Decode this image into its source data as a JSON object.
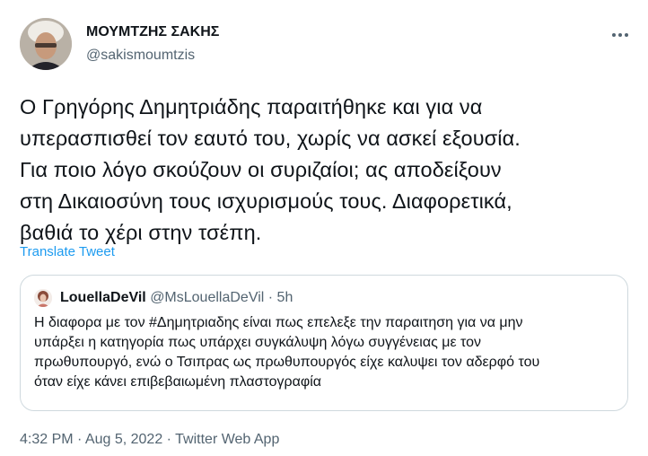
{
  "author": {
    "name": "ΜΟΥΜΤΖΗΣ ΣΑΚΗΣ",
    "handle": "@sakismoumtzis"
  },
  "tweet": {
    "text": "Ο Γρηγόρης Δημητριάδης παραιτήθηκε και για να\nυπερασπισθεί τον εαυτό του, χωρίς να ασκεί εξουσία.\nΓια ποιο λόγο σκούζουν οι συριζαίοι; ας αποδείξουν\nστη Δικαιοσύνη τους ισχυρισμούς τους.  Διαφορετικά,\nβαθιά το χέρι στην τσέπη.",
    "translate_label": "Translate Tweet"
  },
  "quoted_tweet": {
    "name": "LouellaDeVil",
    "handle": "@MsLouellaDeVil",
    "separator": "·",
    "time": "5h",
    "text": "Η διαφορα με τον  #Δημητριαδης είναι πως επελεξε την παραιτηση για να μην\nυπάρξει η κατηγορία πως υπάρχει συγκάλυψη λόγω συγγένειας με τον\nπρωθυπουργό, ενώ ο Τσιπρας ως πρωθυπουργός είχε καλυψει τον αδερφό του\nόταν είχε κάνει επιβεβαιωμένη πλαστογραφία"
  },
  "meta": {
    "timestamp": "4:32 PM · Aug 5, 2022 · Twitter Web App"
  },
  "icons": {
    "more": "more-options-icon"
  },
  "colors": {
    "link": "#1d9bf0",
    "secondary_text": "#536471",
    "border": "#cfd9de"
  }
}
